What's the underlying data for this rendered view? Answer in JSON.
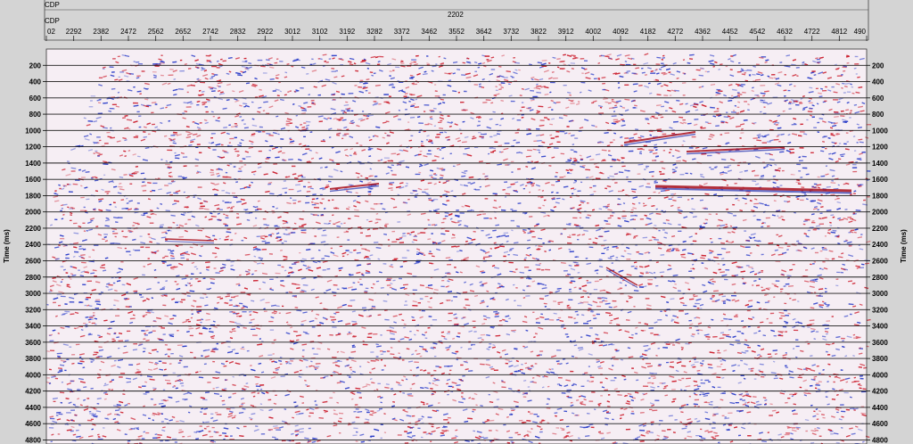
{
  "header": {
    "row1_label": "CDP",
    "row2_label": "CDP",
    "row2_value": "2202"
  },
  "chart_data": {
    "type": "heatmap",
    "title": "",
    "xlabel": "CDP",
    "ylabel": "Time (ms)",
    "x_ticks": [
      "02",
      "2292",
      "2382",
      "2472",
      "2562",
      "2652",
      "2742",
      "2832",
      "2922",
      "3012",
      "3102",
      "3192",
      "3282",
      "3372",
      "3462",
      "3552",
      "3642",
      "3732",
      "3822",
      "3912",
      "4002",
      "4092",
      "4182",
      "4272",
      "4362",
      "4452",
      "4542",
      "4632",
      "4722",
      "4812",
      "490"
    ],
    "y_ticks": [
      200,
      400,
      600,
      800,
      1000,
      1200,
      1400,
      1600,
      1800,
      2000,
      2200,
      2400,
      2600,
      2800,
      3000,
      3200,
      3400,
      3600,
      3800,
      4000,
      4200,
      4400,
      4600,
      4800
    ],
    "ylim": [
      0,
      4850
    ],
    "y_inverted": true,
    "grid": true,
    "colors": {
      "positive": "#cc1f2e",
      "negative": "#2a3cc8",
      "background": "#f6eef4"
    }
  }
}
